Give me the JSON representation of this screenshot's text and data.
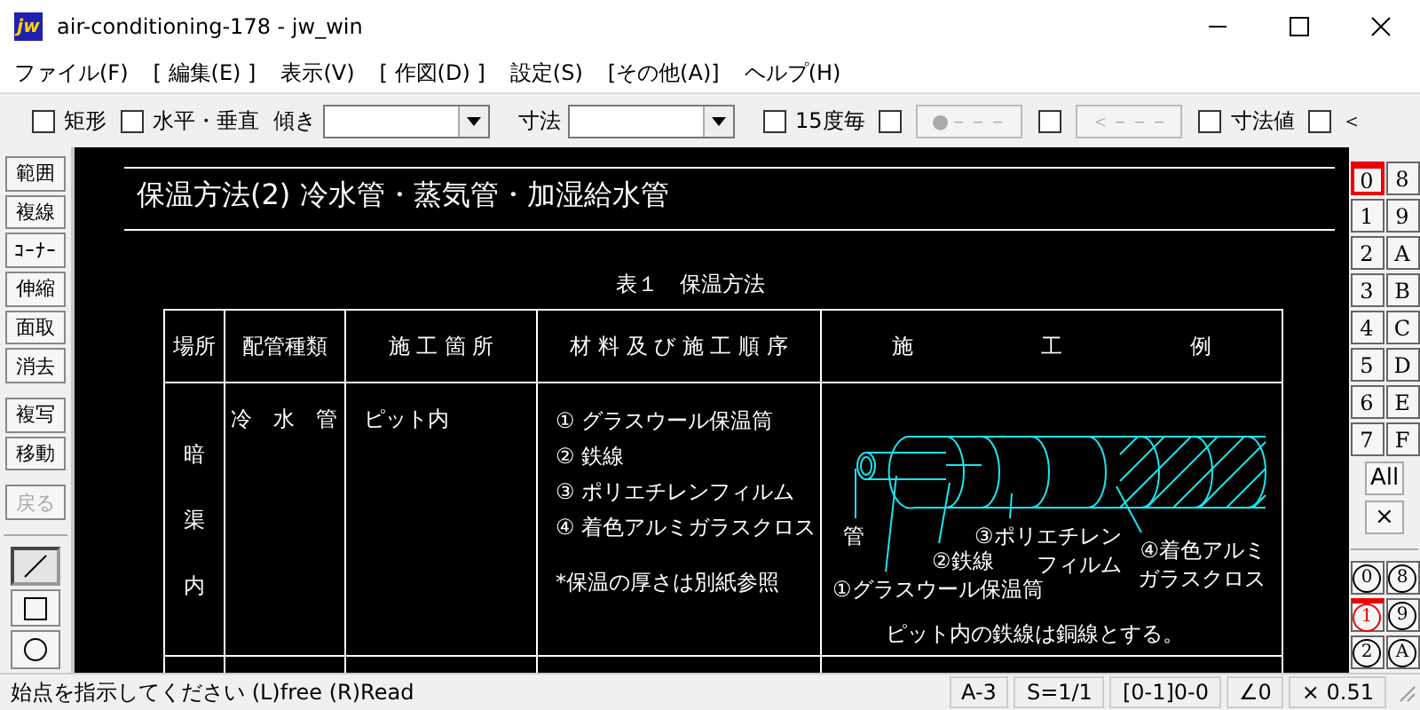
{
  "window": {
    "logo": "jw",
    "title": "air-conditioning-178 - jw_win"
  },
  "menu": [
    "ファイル(F)",
    "[ 編集(E) ]",
    "表示(V)",
    "[ 作図(D) ]",
    "設定(S)",
    "[その他(A)]",
    "ヘルプ(H)"
  ],
  "toolbar": [
    {
      "kind": "checkbox",
      "label": "矩形",
      "checked": false
    },
    {
      "kind": "checkbox",
      "label": "水平・垂直",
      "checked": false
    },
    {
      "kind": "label",
      "label": "傾き"
    },
    {
      "kind": "combo"
    },
    {
      "kind": "label",
      "label": "寸法"
    },
    {
      "kind": "combo"
    },
    {
      "kind": "checkbox",
      "label": "15度毎",
      "checked": false
    },
    {
      "kind": "checkbox",
      "checked": false
    },
    {
      "kind": "button",
      "label": "●－－－",
      "disabled": true
    },
    {
      "kind": "checkbox",
      "checked": false
    },
    {
      "kind": "button",
      "label": "＜－－－",
      "disabled": true
    },
    {
      "kind": "checkbox",
      "label": "寸法値",
      "checked": false
    },
    {
      "kind": "checkbox",
      "label": "＜",
      "checked": false
    }
  ],
  "tools": [
    {
      "label": "範囲",
      "disabled": false
    },
    {
      "label": "複線",
      "disabled": false
    },
    {
      "label": "ｺｰﾅｰ",
      "disabled": false
    },
    {
      "label": "伸縮",
      "disabled": false
    },
    {
      "label": "面取",
      "disabled": false
    },
    {
      "label": "消去",
      "disabled": false
    },
    {
      "label": "複写",
      "disabled": false
    },
    {
      "label": "移動",
      "disabled": false
    },
    {
      "label": "戻る",
      "disabled": true
    }
  ],
  "draw_tools": [
    {
      "kind": "line",
      "selected": true
    },
    {
      "kind": "rect",
      "selected": false
    },
    {
      "kind": "circle",
      "selected": false
    }
  ],
  "canvas": {
    "heading": "保温方法(2) 冷水管・蒸気管・加湿給水管",
    "caption": "表１　保温方法",
    "table": {
      "columns": [
        "場所",
        "配管種類",
        "施 工 箇 所",
        "材 料 及 び 施 工 順 序",
        "施　　　　　　工　　　　　　例"
      ],
      "rows": [
        {
          "place": "暗渠内",
          "pipe": "冷　水　管",
          "location": "ピット内",
          "steps": [
            "①  グラスウール保温筒",
            "②  鉄線",
            "③  ポリエチレンフィルム",
            "④  着色アルミガラスクロス"
          ],
          "note": "*保温の厚さは別紙参照",
          "example": {
            "callouts": {
              "pipe": [
                "管"
              ],
              "wire": [
                "②鉄線"
              ],
              "film": [
                "③ポリエチレン",
                "フィルム"
              ],
              "cloth": [
                "④着色アルミ",
                "ガラスクロス"
              ],
              "glass_wool": [
                "①グラスウール保温筒"
              ]
            },
            "note": "ピット内の鉄線は銅線とする。"
          }
        }
      ]
    }
  },
  "layers": [
    {
      "label": "0",
      "selected": true
    },
    {
      "label": "8",
      "selected": false
    },
    {
      "label": "1",
      "selected": false
    },
    {
      "label": "9",
      "selected": false
    },
    {
      "label": "2",
      "selected": false
    },
    {
      "label": "A",
      "selected": false
    },
    {
      "label": "3",
      "selected": false
    },
    {
      "label": "B",
      "selected": false
    },
    {
      "label": "4",
      "selected": false
    },
    {
      "label": "C",
      "selected": false
    },
    {
      "label": "5",
      "selected": false
    },
    {
      "label": "D",
      "selected": false
    },
    {
      "label": "6",
      "selected": false
    },
    {
      "label": "E",
      "selected": false
    },
    {
      "label": "7",
      "selected": false
    },
    {
      "label": "F",
      "selected": false
    }
  ],
  "layer_buttons": [
    "All",
    "×"
  ],
  "groups": [
    {
      "label": "0",
      "selected": false
    },
    {
      "label": "8",
      "selected": false
    },
    {
      "label": "1",
      "selected": true
    },
    {
      "label": "9",
      "selected": false
    },
    {
      "label": "2",
      "selected": false
    },
    {
      "label": "A",
      "selected": false
    }
  ],
  "status_bar": {
    "message": "始点を指示してください (L)free (R)Read",
    "fields": [
      "A-3",
      "S=1/1",
      "[0-1]0-0",
      "∠0",
      "×  0.51"
    ]
  }
}
